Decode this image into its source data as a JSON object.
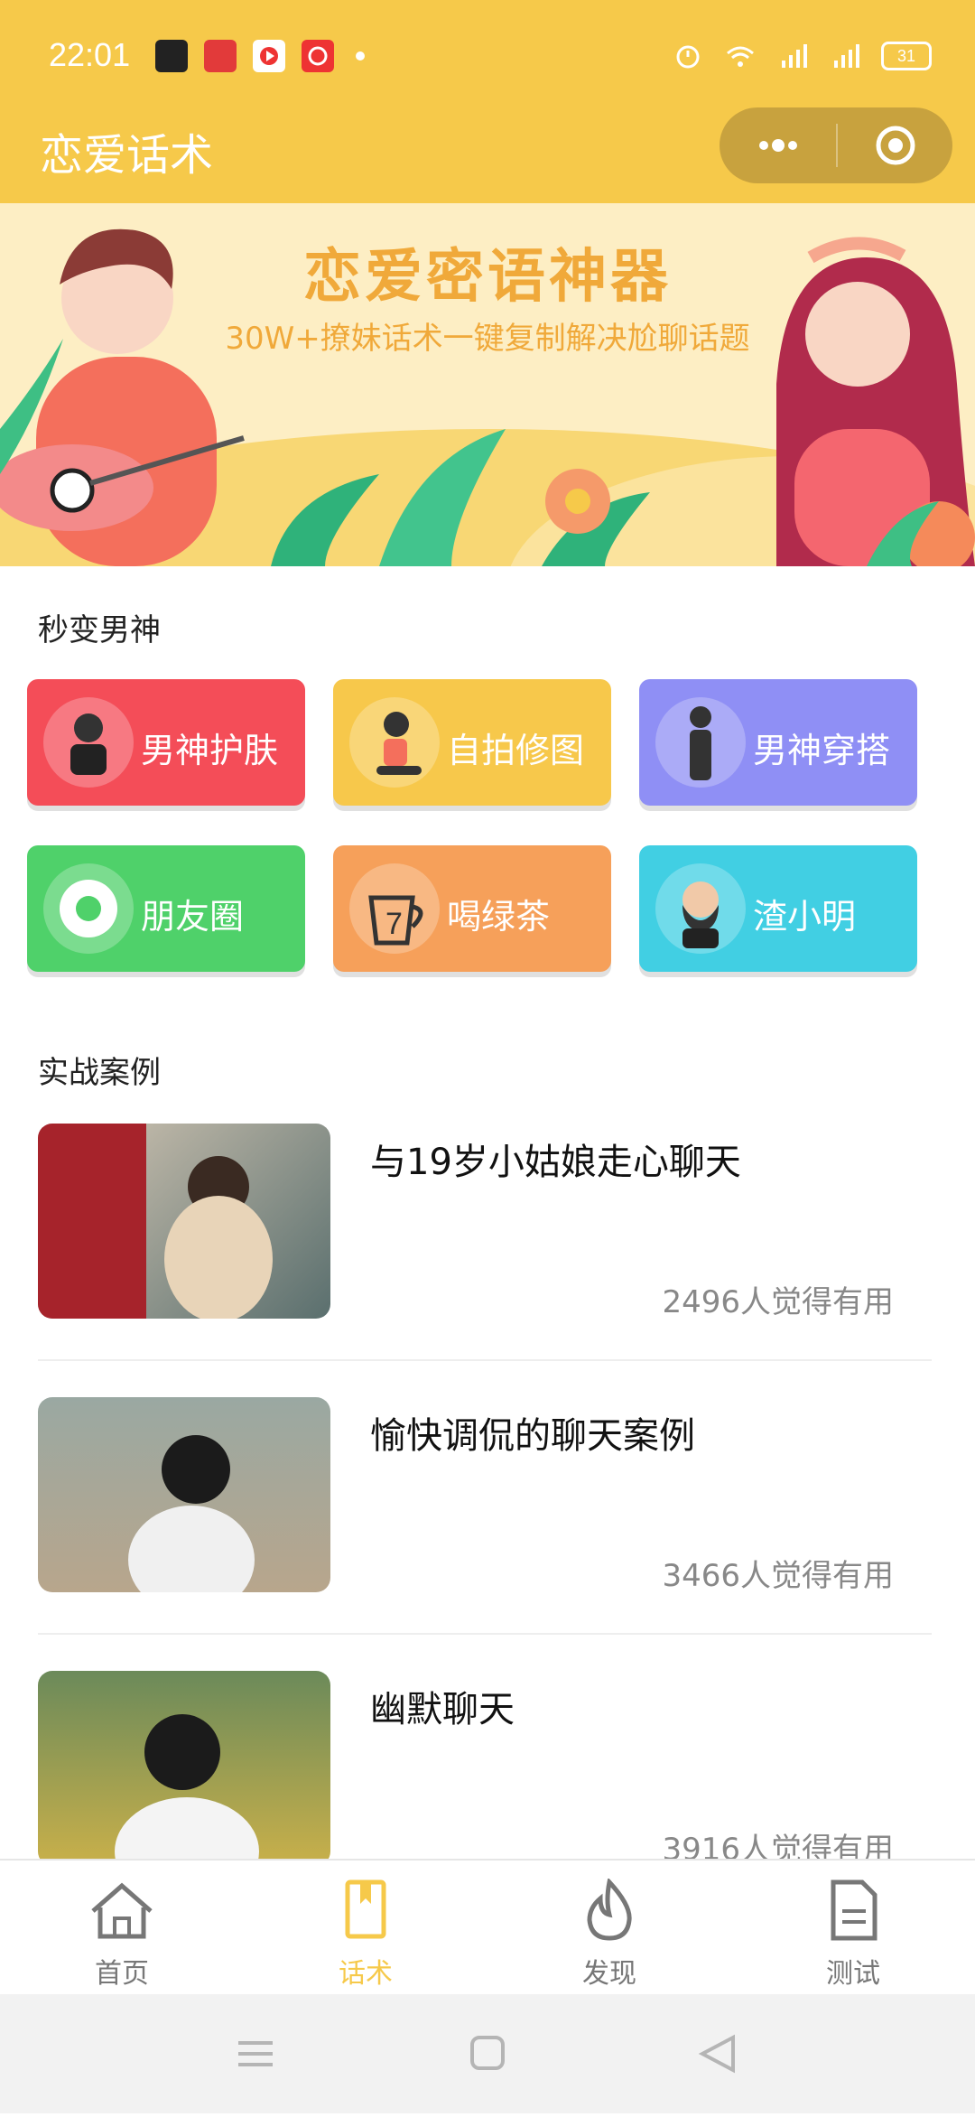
{
  "status_bar": {
    "time": "22:01",
    "battery": "31"
  },
  "header": {
    "title": "恋爱话术"
  },
  "banner": {
    "title": "恋爱密语神器",
    "subtitle": "30W+撩妹话术一键复制解决尬聊话题"
  },
  "section_men": {
    "label": "秒变男神",
    "cards": [
      {
        "label": "男神护肤",
        "color": "#f44d58"
      },
      {
        "label": "自拍修图",
        "color": "#f7c84b"
      },
      {
        "label": "男神穿搭",
        "color": "#8f8ff5"
      },
      {
        "label": "朋友圈",
        "color": "#4fd16a"
      },
      {
        "label": "喝绿茶",
        "color": "#f6a05a"
      },
      {
        "label": "渣小明",
        "color": "#41cfe3"
      }
    ]
  },
  "section_cases": {
    "label": "实战案例",
    "items": [
      {
        "title": "与19岁小姑娘走心聊天",
        "stat": "2496人觉得有用"
      },
      {
        "title": "愉快调侃的聊天案例",
        "stat": "3466人觉得有用"
      },
      {
        "title": "幽默聊天",
        "stat": "3916人觉得有用"
      }
    ]
  },
  "tabbar": {
    "tabs": [
      {
        "label": "首页",
        "icon": "home-icon"
      },
      {
        "label": "话术",
        "icon": "book-icon",
        "active": true
      },
      {
        "label": "发现",
        "icon": "flame-icon"
      },
      {
        "label": "测试",
        "icon": "document-icon"
      }
    ]
  },
  "colors": {
    "accent": "#f6c94a",
    "capsule": "#c8a23e"
  }
}
